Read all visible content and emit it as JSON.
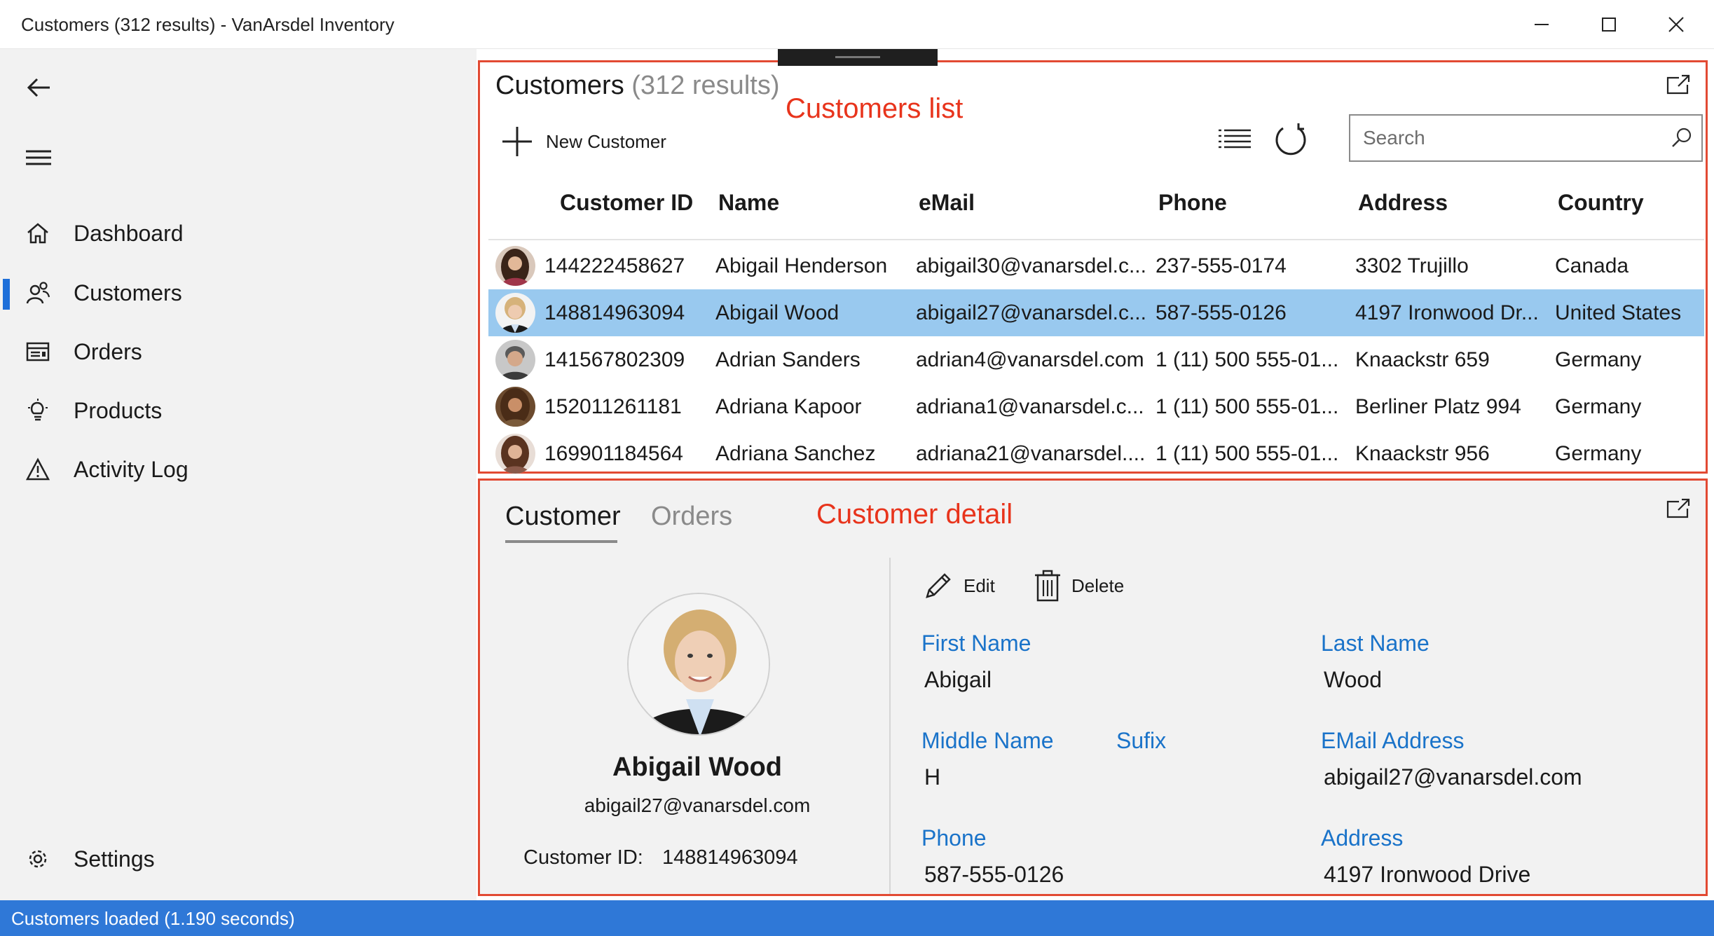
{
  "window": {
    "title": "Customers  (312 results) - VanArsdel Inventory",
    "minimize_icon": "minimize-icon",
    "maximize_icon": "maximize-icon",
    "close_icon": "close-icon"
  },
  "sidebar": {
    "back_icon": "back-arrow-icon",
    "menu_icon": "hamburger-icon",
    "items": [
      {
        "label": "Dashboard",
        "icon": "home-icon"
      },
      {
        "label": "Customers",
        "icon": "people-icon",
        "active": true
      },
      {
        "label": "Orders",
        "icon": "orders-icon"
      },
      {
        "label": "Products",
        "icon": "lightbulb-icon"
      },
      {
        "label": "Activity Log",
        "icon": "warning-icon"
      }
    ],
    "settings": {
      "label": "Settings",
      "icon": "gear-icon"
    }
  },
  "list": {
    "title": "Customers",
    "count": "(312 results)",
    "annotation": "Customers list",
    "new_button": "New Customer",
    "search_placeholder": "Search",
    "columns": [
      "Customer ID",
      "Name",
      "eMail",
      "Phone",
      "Address",
      "Country"
    ],
    "rows": [
      {
        "id": "144222458627",
        "name": "Abigail Henderson",
        "email": "abigail30@vanarsdel.c...",
        "phone": "237-555-0174",
        "address": "3302 Trujillo",
        "country": "Canada"
      },
      {
        "id": "148814963094",
        "name": "Abigail Wood",
        "email": "abigail27@vanarsdel.c...",
        "phone": "587-555-0126",
        "address": "4197 Ironwood Dr...",
        "country": "United States",
        "selected": true
      },
      {
        "id": "141567802309",
        "name": "Adrian Sanders",
        "email": "adrian4@vanarsdel.com",
        "phone": "1 (11) 500 555-01...",
        "address": "Knaackstr 659",
        "country": "Germany"
      },
      {
        "id": "152011261181",
        "name": "Adriana Kapoor",
        "email": "adriana1@vanarsdel.c...",
        "phone": "1 (11) 500 555-01...",
        "address": "Berliner Platz 994",
        "country": "Germany"
      },
      {
        "id": "169901184564",
        "name": "Adriana Sanchez",
        "email": "adriana21@vanarsdel....",
        "phone": "1 (11) 500 555-01...",
        "address": "Knaackstr 956",
        "country": "Germany"
      }
    ]
  },
  "detail": {
    "annotation": "Customer detail",
    "tabs": [
      "Customer",
      "Orders"
    ],
    "name": "Abigail Wood",
    "email": "abigail27@vanarsdel.com",
    "id_label": "Customer ID:",
    "id_value": "148814963094",
    "edit_label": "Edit",
    "delete_label": "Delete",
    "fields": {
      "first_name": {
        "label": "First Name",
        "value": "Abigail"
      },
      "last_name": {
        "label": "Last Name",
        "value": "Wood"
      },
      "middle_name": {
        "label": "Middle Name",
        "value": "H"
      },
      "suffix": {
        "label": "Sufix",
        "value": ""
      },
      "email": {
        "label": "EMail Address",
        "value": "abigail27@vanarsdel.com"
      },
      "phone": {
        "label": "Phone",
        "value": "587-555-0126"
      },
      "address": {
        "label": "Address",
        "value": "4197 Ironwood Drive"
      }
    }
  },
  "status": {
    "text": "Customers loaded (1.190 seconds)"
  },
  "colors": {
    "accent": "#1e6fd9",
    "selection": "#99c9ef",
    "annotation": "#e8341c",
    "field_label": "#1a73c9",
    "status_bar": "#2f78d7"
  }
}
